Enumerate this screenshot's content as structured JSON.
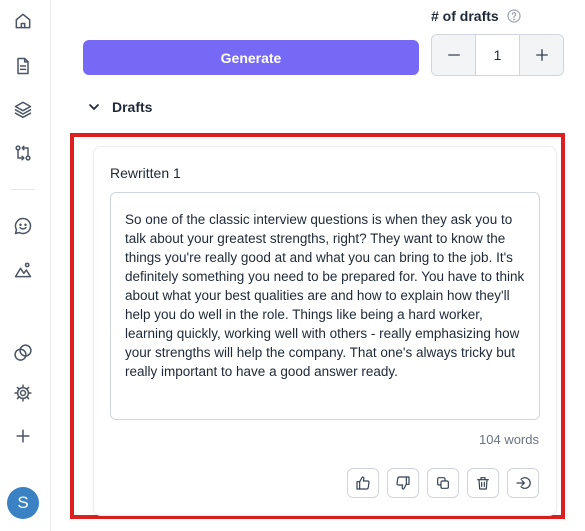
{
  "sidebar": {
    "icons": [
      "home-icon",
      "document-icon",
      "layers-icon",
      "git-compare-icon",
      "chat-icon",
      "image-icon",
      "circles-icon",
      "gear-icon",
      "plus-icon"
    ],
    "avatar_initial": "S"
  },
  "controls": {
    "drafts_count_label": "# of drafts",
    "generate_label": "Generate",
    "drafts_count": "1",
    "section_title": "Drafts"
  },
  "draft": {
    "name": "Rewritten 1",
    "text": "So one of the classic interview questions is when they ask you to talk about your greatest strengths, right? They want to know the things you're really good at and what you can bring to the job. It's definitely something you need to be prepared for. You have to think about what your best qualities are and how to explain how they'll help you do well in the role. Things like being a hard worker, learning quickly, working well with others - really emphasizing how your strengths will help the company. That one's always tricky but really important to have a good answer ready.",
    "word_count": "104 words",
    "actions": [
      "thumbs-up-icon",
      "thumbs-down-icon",
      "copy-icon",
      "trash-icon",
      "insert-icon"
    ]
  },
  "colors": {
    "accent": "#7569f6",
    "highlight": "#dc1f1f",
    "avatar": "#3b82c4"
  }
}
